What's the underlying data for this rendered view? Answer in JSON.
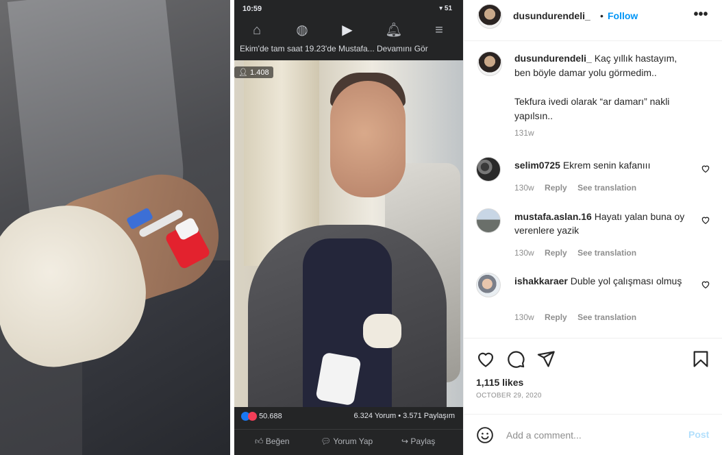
{
  "phone": {
    "status_time": "10:59",
    "status_right": "▾ 51",
    "video_title": "Ekim'de tam saat 19.23'de Mustafa... Devamını Gör",
    "viewer_count": "1.408",
    "reaction_count": "50.688",
    "comments_shares": "6.324 Yorum • 3.571 Paylaşım",
    "actions": [
      "Beğen",
      "Yorum Yap",
      "Paylaş"
    ]
  },
  "post": {
    "username": "dusundurendeli_",
    "separator": "•",
    "follow_label": "Follow",
    "more_icon": "more-options-icon",
    "caption": {
      "line1": "Kaç yıllık hastayım,",
      "line2": "ben böyle damar yolu görmedim..",
      "line3": "Tekfura ivedi olarak “ar damarı” nakli",
      "line4": "yapılsın..",
      "time": "131w"
    },
    "comments": [
      {
        "user": "selim0725",
        "text": "Ekrem senin kafanııı",
        "time": "130w",
        "reply": "Reply",
        "translate": "See translation"
      },
      {
        "user": "mustafa.aslan.16",
        "text": "Hayatı yalan buna oy verenlere yazik",
        "time": "130w",
        "reply": "Reply",
        "translate": "See translation"
      },
      {
        "user": "ishakkaraer",
        "text": "Duble yol çalışması olmuş",
        "time": "130w",
        "reply": "Reply",
        "translate": "See translation"
      }
    ],
    "likes": "1,115 likes",
    "date": "OCTOBER 29, 2020",
    "add_comment_placeholder": "Add a comment...",
    "post_label": "Post"
  },
  "colors": {
    "accent": "#0095f6",
    "post_disabled": "#b2dffc",
    "secondary_text": "#8e8e8e"
  }
}
